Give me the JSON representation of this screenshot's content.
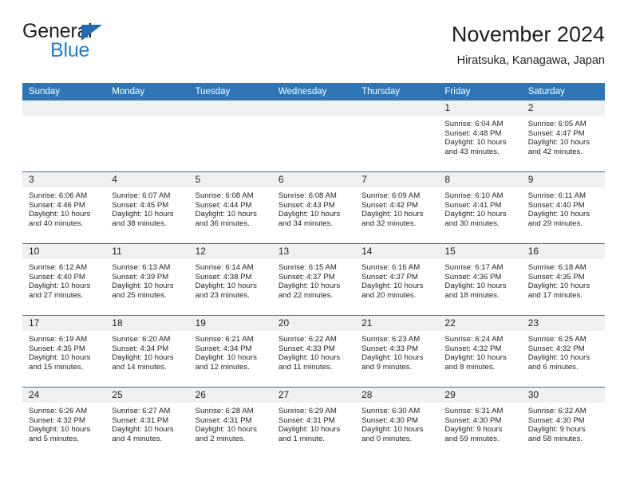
{
  "brand": {
    "name_part1": "General",
    "name_part2": "Blue",
    "triangle_color": "#1f6cb4",
    "blue_text_color": "#1f7fd4"
  },
  "header": {
    "title": "November 2024",
    "subtitle": "Hiratsuka, Kanagawa, Japan"
  },
  "theme": {
    "header_bg": "#2e75b6",
    "daynum_bg": "#f0f0f0",
    "separator": "#2e75b6",
    "text": "#231f20"
  },
  "columns": [
    {
      "label": "Sunday"
    },
    {
      "label": "Monday"
    },
    {
      "label": "Tuesday"
    },
    {
      "label": "Wednesday"
    },
    {
      "label": "Thursday"
    },
    {
      "label": "Friday"
    },
    {
      "label": "Saturday"
    }
  ],
  "weeks": [
    [
      {
        "day": "",
        "sunrise": "",
        "sunset": "",
        "daylight": "",
        "empty": true
      },
      {
        "day": "",
        "sunrise": "",
        "sunset": "",
        "daylight": "",
        "empty": true
      },
      {
        "day": "",
        "sunrise": "",
        "sunset": "",
        "daylight": "",
        "empty": true
      },
      {
        "day": "",
        "sunrise": "",
        "sunset": "",
        "daylight": "",
        "empty": true
      },
      {
        "day": "",
        "sunrise": "",
        "sunset": "",
        "daylight": "",
        "empty": true
      },
      {
        "day": "1",
        "sunrise": "Sunrise: 6:04 AM",
        "sunset": "Sunset: 4:48 PM",
        "daylight": "Daylight: 10 hours and 43 minutes.",
        "empty": false
      },
      {
        "day": "2",
        "sunrise": "Sunrise: 6:05 AM",
        "sunset": "Sunset: 4:47 PM",
        "daylight": "Daylight: 10 hours and 42 minutes.",
        "empty": false
      }
    ],
    [
      {
        "day": "3",
        "sunrise": "Sunrise: 6:06 AM",
        "sunset": "Sunset: 4:46 PM",
        "daylight": "Daylight: 10 hours and 40 minutes.",
        "empty": false
      },
      {
        "day": "4",
        "sunrise": "Sunrise: 6:07 AM",
        "sunset": "Sunset: 4:45 PM",
        "daylight": "Daylight: 10 hours and 38 minutes.",
        "empty": false
      },
      {
        "day": "5",
        "sunrise": "Sunrise: 6:08 AM",
        "sunset": "Sunset: 4:44 PM",
        "daylight": "Daylight: 10 hours and 36 minutes.",
        "empty": false
      },
      {
        "day": "6",
        "sunrise": "Sunrise: 6:08 AM",
        "sunset": "Sunset: 4:43 PM",
        "daylight": "Daylight: 10 hours and 34 minutes.",
        "empty": false
      },
      {
        "day": "7",
        "sunrise": "Sunrise: 6:09 AM",
        "sunset": "Sunset: 4:42 PM",
        "daylight": "Daylight: 10 hours and 32 minutes.",
        "empty": false
      },
      {
        "day": "8",
        "sunrise": "Sunrise: 6:10 AM",
        "sunset": "Sunset: 4:41 PM",
        "daylight": "Daylight: 10 hours and 30 minutes.",
        "empty": false
      },
      {
        "day": "9",
        "sunrise": "Sunrise: 6:11 AM",
        "sunset": "Sunset: 4:40 PM",
        "daylight": "Daylight: 10 hours and 29 minutes.",
        "empty": false
      }
    ],
    [
      {
        "day": "10",
        "sunrise": "Sunrise: 6:12 AM",
        "sunset": "Sunset: 4:40 PM",
        "daylight": "Daylight: 10 hours and 27 minutes.",
        "empty": false
      },
      {
        "day": "11",
        "sunrise": "Sunrise: 6:13 AM",
        "sunset": "Sunset: 4:39 PM",
        "daylight": "Daylight: 10 hours and 25 minutes.",
        "empty": false
      },
      {
        "day": "12",
        "sunrise": "Sunrise: 6:14 AM",
        "sunset": "Sunset: 4:38 PM",
        "daylight": "Daylight: 10 hours and 23 minutes.",
        "empty": false
      },
      {
        "day": "13",
        "sunrise": "Sunrise: 6:15 AM",
        "sunset": "Sunset: 4:37 PM",
        "daylight": "Daylight: 10 hours and 22 minutes.",
        "empty": false
      },
      {
        "day": "14",
        "sunrise": "Sunrise: 6:16 AM",
        "sunset": "Sunset: 4:37 PM",
        "daylight": "Daylight: 10 hours and 20 minutes.",
        "empty": false
      },
      {
        "day": "15",
        "sunrise": "Sunrise: 6:17 AM",
        "sunset": "Sunset: 4:36 PM",
        "daylight": "Daylight: 10 hours and 18 minutes.",
        "empty": false
      },
      {
        "day": "16",
        "sunrise": "Sunrise: 6:18 AM",
        "sunset": "Sunset: 4:35 PM",
        "daylight": "Daylight: 10 hours and 17 minutes.",
        "empty": false
      }
    ],
    [
      {
        "day": "17",
        "sunrise": "Sunrise: 6:19 AM",
        "sunset": "Sunset: 4:35 PM",
        "daylight": "Daylight: 10 hours and 15 minutes.",
        "empty": false
      },
      {
        "day": "18",
        "sunrise": "Sunrise: 6:20 AM",
        "sunset": "Sunset: 4:34 PM",
        "daylight": "Daylight: 10 hours and 14 minutes.",
        "empty": false
      },
      {
        "day": "19",
        "sunrise": "Sunrise: 6:21 AM",
        "sunset": "Sunset: 4:34 PM",
        "daylight": "Daylight: 10 hours and 12 minutes.",
        "empty": false
      },
      {
        "day": "20",
        "sunrise": "Sunrise: 6:22 AM",
        "sunset": "Sunset: 4:33 PM",
        "daylight": "Daylight: 10 hours and 11 minutes.",
        "empty": false
      },
      {
        "day": "21",
        "sunrise": "Sunrise: 6:23 AM",
        "sunset": "Sunset: 4:33 PM",
        "daylight": "Daylight: 10 hours and 9 minutes.",
        "empty": false
      },
      {
        "day": "22",
        "sunrise": "Sunrise: 6:24 AM",
        "sunset": "Sunset: 4:32 PM",
        "daylight": "Daylight: 10 hours and 8 minutes.",
        "empty": false
      },
      {
        "day": "23",
        "sunrise": "Sunrise: 6:25 AM",
        "sunset": "Sunset: 4:32 PM",
        "daylight": "Daylight: 10 hours and 6 minutes.",
        "empty": false
      }
    ],
    [
      {
        "day": "24",
        "sunrise": "Sunrise: 6:26 AM",
        "sunset": "Sunset: 4:32 PM",
        "daylight": "Daylight: 10 hours and 5 minutes.",
        "empty": false
      },
      {
        "day": "25",
        "sunrise": "Sunrise: 6:27 AM",
        "sunset": "Sunset: 4:31 PM",
        "daylight": "Daylight: 10 hours and 4 minutes.",
        "empty": false
      },
      {
        "day": "26",
        "sunrise": "Sunrise: 6:28 AM",
        "sunset": "Sunset: 4:31 PM",
        "daylight": "Daylight: 10 hours and 2 minutes.",
        "empty": false
      },
      {
        "day": "27",
        "sunrise": "Sunrise: 6:29 AM",
        "sunset": "Sunset: 4:31 PM",
        "daylight": "Daylight: 10 hours and 1 minute.",
        "empty": false
      },
      {
        "day": "28",
        "sunrise": "Sunrise: 6:30 AM",
        "sunset": "Sunset: 4:30 PM",
        "daylight": "Daylight: 10 hours and 0 minutes.",
        "empty": false
      },
      {
        "day": "29",
        "sunrise": "Sunrise: 6:31 AM",
        "sunset": "Sunset: 4:30 PM",
        "daylight": "Daylight: 9 hours and 59 minutes.",
        "empty": false
      },
      {
        "day": "30",
        "sunrise": "Sunrise: 6:32 AM",
        "sunset": "Sunset: 4:30 PM",
        "daylight": "Daylight: 9 hours and 58 minutes.",
        "empty": false
      }
    ]
  ]
}
